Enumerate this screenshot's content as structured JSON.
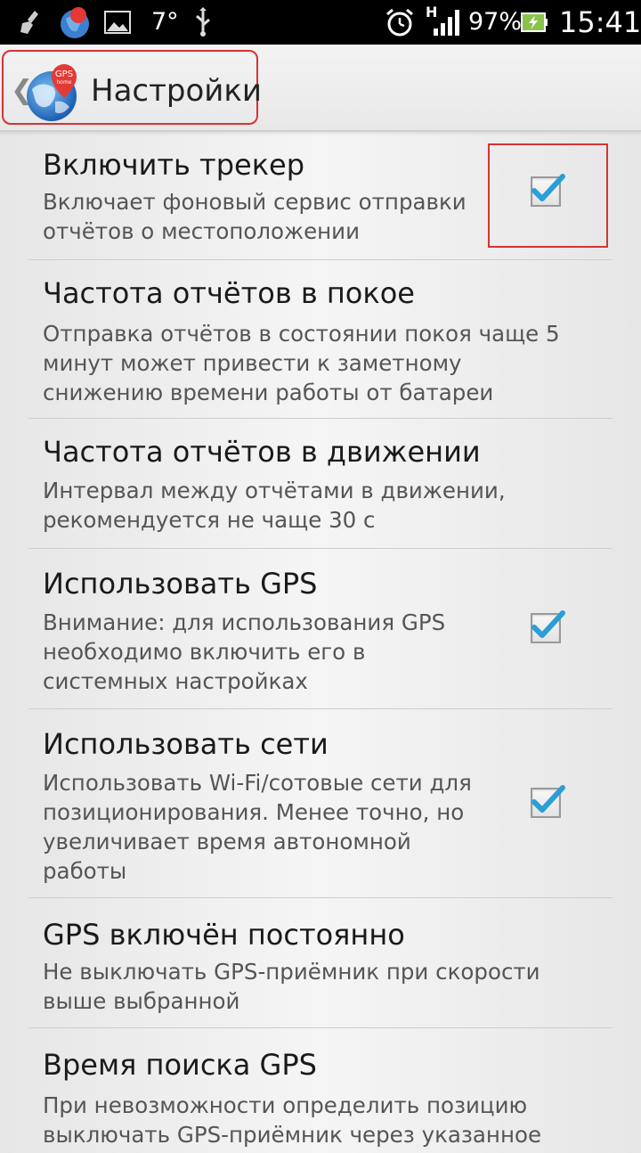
{
  "status_bar": {
    "icons": [
      "broom-icon",
      "gps-home-icon",
      "image-icon",
      "temperature-icon",
      "usb-icon",
      "alarm-clock-icon",
      "signal-icon",
      "battery-icon"
    ],
    "temperature": "7°",
    "signal_type": "H",
    "battery": "97%",
    "clock": "15:41"
  },
  "action_bar": {
    "title": "Настройки",
    "app_icon_text": "GPS",
    "app_icon_subtext": "home"
  },
  "preferences": [
    {
      "title": "Включить трекер",
      "summary": "Включает фоновый сервис отправки отчётов о местоположении",
      "checked": true
    },
    {
      "title": "Частота отчётов в покое",
      "summary": "Отправка отчётов в состоянии покоя чаще 5 минут может привести к заметному снижению времени работы от батареи"
    },
    {
      "title": "Частота отчётов в движении",
      "summary": "Интервал между отчётами в движении, рекомендуется не чаще 30 с"
    },
    {
      "title": "Использовать GPS",
      "summary": "Внимание: для использования GPS необходимо включить его в системных настройках",
      "checked": true
    },
    {
      "title": "Использовать сети",
      "summary": "Использовать Wi-Fi/сотовые сети для позиционирования. Менее точно, но увеличивает время автономной работы",
      "checked": true
    },
    {
      "title": "GPS включён постоянно",
      "summary": "Не выключать GPS-приёмник при скорости выше выбранной"
    },
    {
      "title": "Время поиска GPS",
      "summary": "При невозможности определить позицию выключать GPS-приёмник через указанное"
    }
  ],
  "colors": {
    "accent_check": "#2a9fd6",
    "highlight": "#d63333"
  }
}
